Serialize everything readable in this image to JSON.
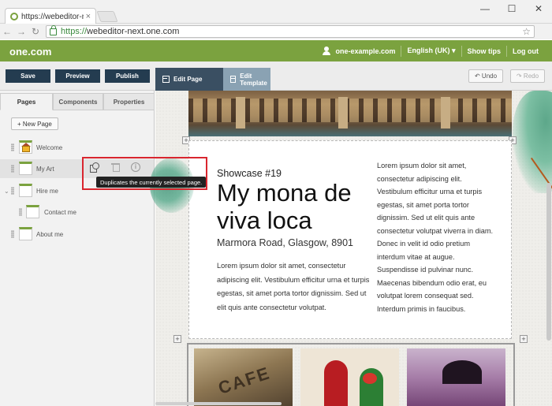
{
  "browser": {
    "tab_title": "https://webeditor-next.one",
    "url_https": "https://",
    "url_rest": "webeditor-next.one.com",
    "win_min": "—",
    "win_max": "☐",
    "win_close": "✕"
  },
  "header": {
    "logo": "one.com",
    "account": "one-example.com",
    "language": "English (UK) ▾",
    "show_tips": "Show tips",
    "logout": "Log out"
  },
  "toolbar": {
    "save": "Save",
    "preview": "Preview",
    "publish": "Publish",
    "edit_page": "Edit Page",
    "edit_template": "Edit Template",
    "undo": "↶ Undo",
    "redo": "↷ Redo"
  },
  "sidebar": {
    "tabs": [
      "Pages",
      "Components",
      "Properties"
    ],
    "new_page": "+ New Page",
    "pages": [
      {
        "label": "Welcome"
      },
      {
        "label": "My Art"
      },
      {
        "label": "Hire me"
      },
      {
        "label": "Contact me"
      },
      {
        "label": "About me"
      }
    ],
    "tooltip": "Duplicates the currently selected page."
  },
  "content": {
    "showcase": "Showcase #19",
    "title": "My mona de viva loca",
    "address": "Marmora Road, Glasgow, 8901",
    "para1": "Lorem ipsum dolor sit amet, consectetur adipiscing elit. Vestibulum efficitur urna et turpis egestas, sit amet porta tortor dignissim. Sed ut elit quis ante consectetur volutpat.",
    "para2": "Lorem ipsum dolor sit amet, consectetur adipiscing elit. Vestibulum efficitur urna et turpis egestas, sit amet porta tortor dignissim. Sed ut elit quis ante consectetur volutpat viverra in diam. Donec in velit id odio pretium interdum vitae at augue. Suspendisse id pulvinar nunc. Maecenas bibendum odio erat, eu volutpat lorem consequat sed. Interdum primis in faucibus.",
    "coffee_text": "CAFE"
  },
  "colors": {
    "brand_green": "#7ba23f",
    "dark_button": "#243c50",
    "active_mode": "#3a4f62",
    "inactive_mode": "#8aa2b3",
    "highlight_red": "#d9262f"
  }
}
